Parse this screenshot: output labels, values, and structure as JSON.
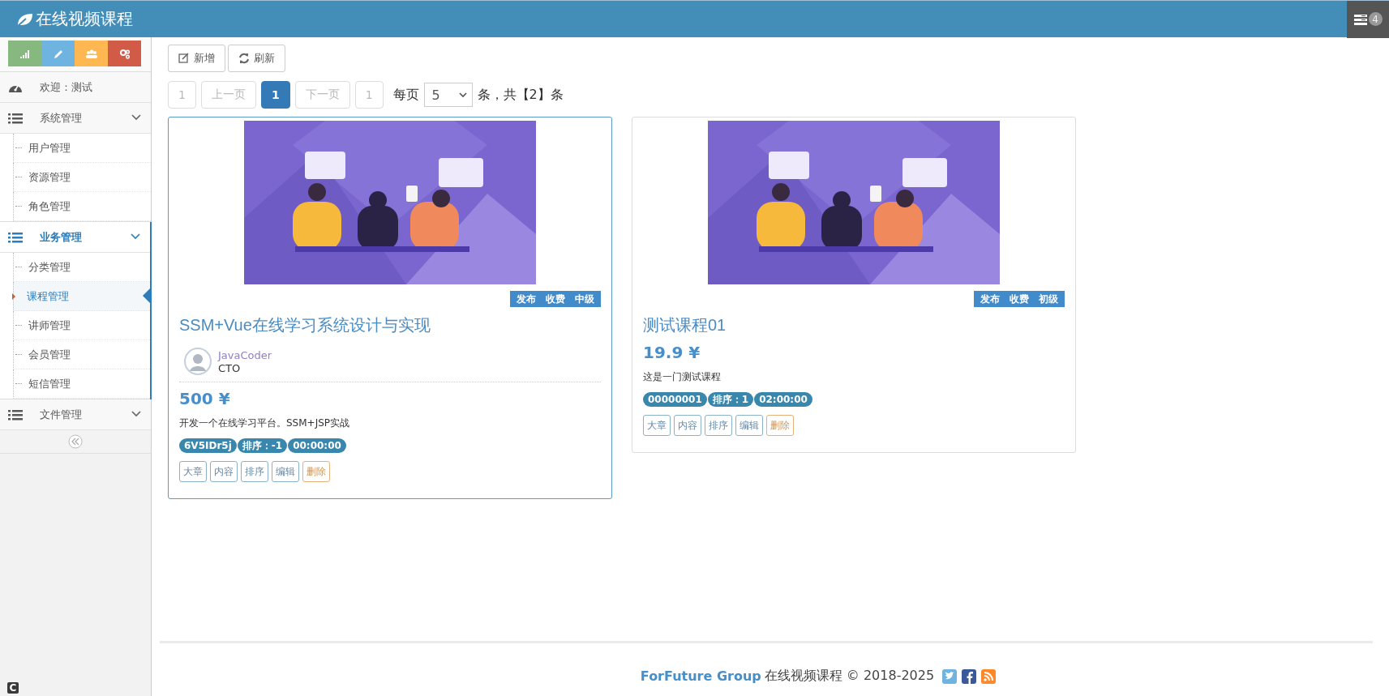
{
  "header": {
    "title": "在线视频课程",
    "badge": "4"
  },
  "sidebar": {
    "shortcuts": [
      {
        "kind": "chart",
        "color": "#87b87f"
      },
      {
        "kind": "pencil",
        "color": "#6fb3e0"
      },
      {
        "kind": "users",
        "color": "#ffb752"
      },
      {
        "kind": "cogs",
        "color": "#d15b47"
      }
    ],
    "welcome": "欢迎：测试",
    "menus": [
      {
        "label": "系统管理",
        "selected": false,
        "children": [
          {
            "label": "用户管理",
            "selected": false
          },
          {
            "label": "资源管理",
            "selected": false
          },
          {
            "label": "角色管理",
            "selected": false
          }
        ]
      },
      {
        "label": "业务管理",
        "selected": true,
        "children": [
          {
            "label": "分类管理",
            "selected": false
          },
          {
            "label": "课程管理",
            "selected": true
          },
          {
            "label": "讲师管理",
            "selected": false
          },
          {
            "label": "会员管理",
            "selected": false
          },
          {
            "label": "短信管理",
            "selected": false
          }
        ]
      },
      {
        "label": "文件管理",
        "selected": false
      }
    ]
  },
  "toolbar": [
    {
      "kind": "add",
      "label": "新增"
    },
    {
      "kind": "refresh",
      "label": "刷新"
    }
  ],
  "pagination": {
    "items": [
      {
        "label": "1",
        "disabled": true,
        "selected": false
      },
      {
        "label": "上一页",
        "disabled": true,
        "selected": false
      },
      {
        "label": "1",
        "disabled": false,
        "selected": true
      },
      {
        "label": "下一页",
        "disabled": true,
        "selected": false
      },
      {
        "label": "1",
        "disabled": true,
        "selected": false
      }
    ],
    "per_page_label": "每页",
    "page_size": "5",
    "summary": "条，共【2】条"
  },
  "cards": [
    {
      "selected": true,
      "tags": [
        "发布",
        "收费",
        "中级"
      ],
      "title": "SSM+Vue在线学习系统设计与实现",
      "teacher": {
        "name": "JavaCoder",
        "role": "CTO"
      },
      "price": "500 ¥",
      "description": "开发一个在线学习平台。SSM+JSP实战",
      "badges": [
        "6V5IDr5j",
        "排序：-1",
        "00:00:00"
      ],
      "actions": [
        {
          "kind": "normal",
          "label": "大章"
        },
        {
          "kind": "normal",
          "label": "内容"
        },
        {
          "kind": "normal",
          "label": "排序"
        },
        {
          "kind": "normal",
          "label": "编辑"
        },
        {
          "kind": "danger",
          "label": "删除"
        }
      ]
    },
    {
      "selected": false,
      "tags": [
        "发布",
        "收费",
        "初级"
      ],
      "title": "测试课程01",
      "price": "19.9 ¥",
      "description": "这是一门测试课程",
      "badges": [
        "00000001",
        "排序：1",
        "02:00:00"
      ],
      "actions": [
        {
          "kind": "normal",
          "label": "大章"
        },
        {
          "kind": "normal",
          "label": "内容"
        },
        {
          "kind": "normal",
          "label": "排序"
        },
        {
          "kind": "normal",
          "label": "编辑"
        },
        {
          "kind": "danger",
          "label": "删除"
        }
      ]
    }
  ],
  "footer": {
    "brand": "ForFuture Group",
    "text": "在线视频课程 © 2018-2025",
    "social": [
      {
        "kind": "bird",
        "color": "#6fb3e0"
      },
      {
        "kind": "f",
        "color": "#3b5998"
      },
      {
        "kind": "rss",
        "color": "#ff892a"
      }
    ]
  },
  "corner": "C"
}
